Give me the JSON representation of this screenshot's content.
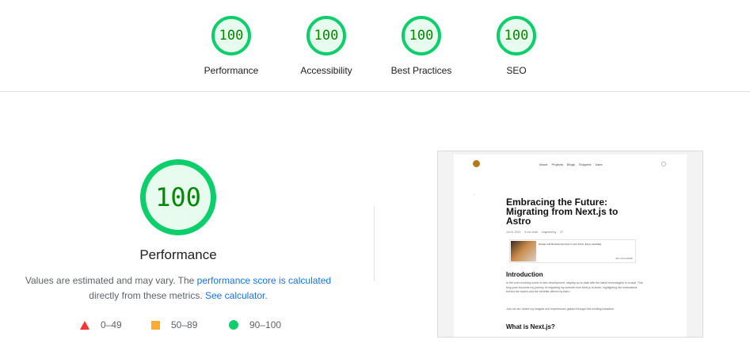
{
  "summary": {
    "categories": [
      {
        "label": "Performance",
        "score": "100"
      },
      {
        "label": "Accessibility",
        "score": "100"
      },
      {
        "label": "Best Practices",
        "score": "100"
      },
      {
        "label": "SEO",
        "score": "100"
      }
    ]
  },
  "performance": {
    "score": "100",
    "title": "Performance",
    "desc_part1": "Values are estimated and may vary. The ",
    "desc_link1": "performance score is calculated",
    "desc_part2": " directly from these metrics. ",
    "desc_link2": "See calculator",
    "desc_part3": ".",
    "legend": {
      "fail": "0–49",
      "average": "50–89",
      "pass": "90–100"
    }
  },
  "colors": {
    "pass": "#0cce6b",
    "average": "#ffaa33",
    "fail": "#ff3333",
    "link": "#1a73e8",
    "score_text": "#008800"
  },
  "screenshot": {
    "nav": [
      "About",
      "Projects",
      "Blogs",
      "Snippets",
      "Uses"
    ],
    "back": "←",
    "title": "Embracing the Future: Migrating from Next.js to Astro",
    "meta": [
      "Jun 8, 2023",
      "5 min read",
      "engineering",
      "37"
    ],
    "card_text": "Design and Development tips in your inbox. Every weekday.",
    "card_link": "Join our network",
    "intro_heading": "Introduction",
    "intro_p1": "In the ever-evolving world of web development, staying up-to-date with the latest technologies is crucial. This blog post recounts my journey of migrating my website from Next.js to Astro, highlighting the motivations behind the switch and the benefits offered by Astro.",
    "intro_p2": "Join me as I share my insights and experiences gained through this exciting transition.",
    "next_heading": "What is Next.js?"
  }
}
